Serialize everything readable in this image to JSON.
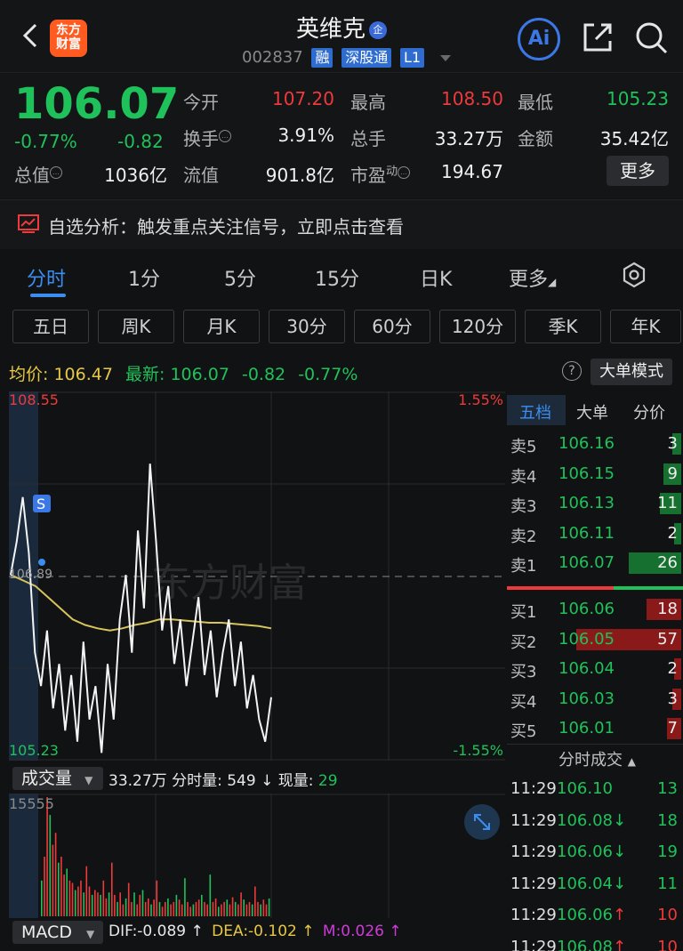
{
  "header": {
    "stock_name": "英维克",
    "name_badge": "企",
    "code": "002837",
    "badges": [
      "融",
      "深股通",
      "L1"
    ],
    "logo_text": [
      "东方",
      "财富"
    ],
    "ai_label": "Ai"
  },
  "quote": {
    "price": "106.07",
    "change_pct": "-0.77%",
    "change": "-0.82",
    "open_label": "今开",
    "open": "107.20",
    "high_label": "最高",
    "high": "108.50",
    "low_label": "最低",
    "low": "105.23",
    "turnover_label": "换手",
    "turnover": "3.91%",
    "volume_label": "总手",
    "volume": "33.27万",
    "amount_label": "金额",
    "amount": "35.42亿",
    "mktcap_label": "总值",
    "mktcap": "1036亿",
    "float_label": "流值",
    "float": "901.8亿",
    "pe_label": "市盈",
    "pe_sup": "动",
    "pe": "194.67",
    "more_label": "更多"
  },
  "alert": {
    "text": "自选分析：触发重点关注信号，立即点击查看"
  },
  "tabs": [
    {
      "label": "分时",
      "active": true
    },
    {
      "label": "1分"
    },
    {
      "label": "5分"
    },
    {
      "label": "15分"
    },
    {
      "label": "日K"
    },
    {
      "label": "更多"
    }
  ],
  "periods": [
    "五日",
    "周K",
    "月K",
    "30分",
    "60分",
    "120分",
    "季K",
    "年K"
  ],
  "avg_row": {
    "avg_label": "均价:",
    "avg": "106.47",
    "latest_label": "最新:",
    "latest": "106.07",
    "change": "-0.82",
    "change_pct": "-0.77%",
    "help": "?",
    "bigorder_label": "大单模式"
  },
  "chart_data": {
    "type": "line",
    "ylim": [
      105.23,
      108.55
    ],
    "top_left": "108.55",
    "bottom_left": "105.23",
    "top_right": "1.55%",
    "bottom_right": "-1.55%",
    "mid_label": "106.89",
    "signal_marker": "S",
    "watermark": "东方财富",
    "series": [
      {
        "name": "price",
        "values": [
          106.9,
          107.2,
          107.6,
          107.1,
          106.2,
          105.9,
          106.4,
          105.7,
          106.1,
          105.5,
          106.0,
          105.4,
          106.3,
          105.6,
          105.9,
          105.3,
          106.1,
          105.6,
          106.5,
          106.9,
          106.2,
          107.3,
          106.6,
          107.9,
          107.2,
          106.4,
          106.8,
          106.1,
          106.5,
          105.9,
          106.3,
          106.7,
          106.0,
          106.4,
          105.8,
          106.2,
          106.5,
          105.9,
          106.3,
          105.7,
          106.0,
          105.6,
          105.4,
          105.8
        ]
      },
      {
        "name": "avg",
        "values": [
          106.9,
          106.85,
          106.8,
          106.7,
          106.6,
          106.5,
          106.45,
          106.42,
          106.4,
          106.42,
          106.45,
          106.47,
          106.5,
          106.5,
          106.49,
          106.48,
          106.47,
          106.47,
          106.46,
          106.45,
          106.44,
          106.42
        ]
      }
    ]
  },
  "book": {
    "tabs": [
      "五档",
      "大单",
      "分价"
    ],
    "sell": [
      {
        "label": "卖5",
        "price": "106.16",
        "vol": "3",
        "bar": 0.05
      },
      {
        "label": "卖4",
        "price": "106.15",
        "vol": "9",
        "bar": 0.1
      },
      {
        "label": "卖3",
        "price": "106.13",
        "vol": "11",
        "bar": 0.12
      },
      {
        "label": "卖2",
        "price": "106.11",
        "vol": "2",
        "bar": 0.04
      },
      {
        "label": "卖1",
        "price": "106.07",
        "vol": "26",
        "bar": 0.3
      }
    ],
    "buy": [
      {
        "label": "买1",
        "price": "106.06",
        "vol": "18",
        "bar": 0.2
      },
      {
        "label": "买2",
        "price": "106.05",
        "vol": "57",
        "bar": 0.6
      },
      {
        "label": "买3",
        "price": "106.04",
        "vol": "2",
        "bar": 0.04
      },
      {
        "label": "买4",
        "price": "106.03",
        "vol": "3",
        "bar": 0.05
      },
      {
        "label": "买5",
        "price": "106.01",
        "vol": "7",
        "bar": 0.08
      }
    ],
    "ticks_title": "分时成交",
    "ticks": [
      {
        "time": "11:29",
        "price": "106.10",
        "arrow": "",
        "vol": "13",
        "color": "green"
      },
      {
        "time": "11:29",
        "price": "106.08↓",
        "arrow": "",
        "vol": "18",
        "color": "green"
      },
      {
        "time": "11:29",
        "price": "106.06↓",
        "arrow": "",
        "vol": "19",
        "color": "green"
      },
      {
        "time": "11:29",
        "price": "106.04↓",
        "arrow": "",
        "vol": "11",
        "color": "green"
      },
      {
        "time": "11:29",
        "price": "106.06",
        "arrow": "↑",
        "vol": "10",
        "color": "red"
      },
      {
        "time": "11:29",
        "price": "106.08",
        "arrow": "↑",
        "vol": "10",
        "color": "red"
      }
    ]
  },
  "volume": {
    "header": "成交量",
    "total": "33.27万",
    "tick_label": "分时量:",
    "tick": "549",
    "now_label": "现量:",
    "now": "29",
    "max_label": "15555",
    "bars": [
      0.3,
      0.5,
      1.0,
      0.85,
      0.6,
      0.7,
      0.45,
      0.5,
      0.35,
      0.4,
      0.3,
      0.28,
      0.22,
      0.25,
      0.3,
      0.2,
      0.42,
      0.25,
      0.18,
      0.22,
      0.2,
      0.18,
      0.3,
      0.15,
      0.2,
      0.45,
      0.18,
      0.12,
      0.2,
      0.1,
      0.15,
      0.28,
      0.12,
      0.2,
      0.1,
      0.18,
      0.22,
      0.12,
      0.15,
      0.1,
      0.14,
      0.3,
      0.12,
      0.08,
      0.12,
      0.15,
      0.1,
      0.12,
      0.18,
      0.14,
      0.1,
      0.32,
      0.12,
      0.08,
      0.1,
      0.12,
      0.14,
      0.18,
      0.12,
      0.1,
      0.35,
      0.12,
      0.15,
      0.08,
      0.1,
      0.12,
      0.14,
      0.1,
      0.16,
      0.12,
      0.1,
      0.2,
      0.14,
      0.1,
      0.12,
      0.1,
      0.25,
      0.12,
      0.1,
      0.14,
      0.1,
      0.15
    ]
  },
  "macd": {
    "header": "MACD",
    "dif": "DIF:-0.089 ↑",
    "dea": "DEA:-0.102 ↑",
    "m": "M:0.026 ↑"
  },
  "colors": {
    "up": "#ee3a3a",
    "down": "#1fc25a",
    "accent": "#3b8ef0",
    "avg": "#d8c45a"
  }
}
